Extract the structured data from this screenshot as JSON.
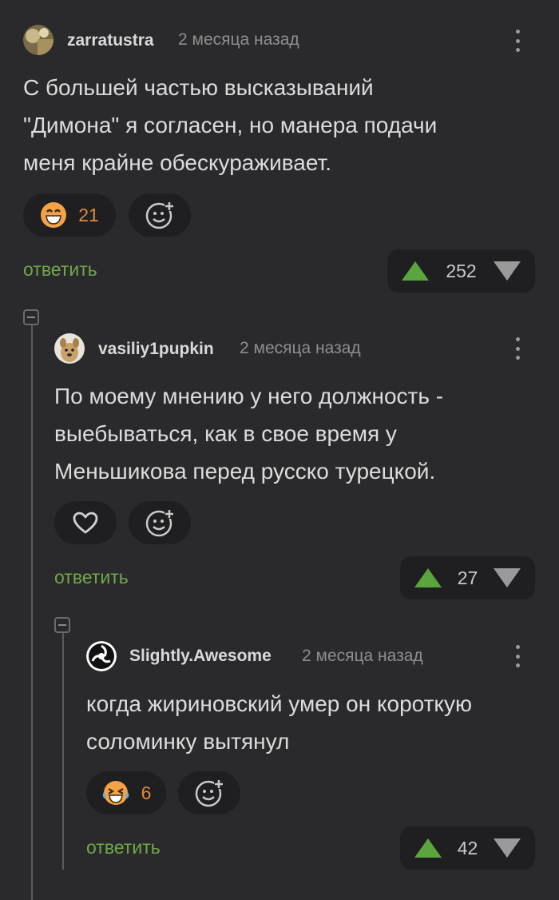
{
  "comments": [
    {
      "author": "zarratustra",
      "time": "2 месяца назад",
      "text_lines": [
        "С большей частью высказываний",
        "\"Димона\" я согласен, но манера подачи",
        "меня крайне обескураживает."
      ],
      "reaction_icon": "grinning-face-icon",
      "reaction_count": "21",
      "reply_label": "ответить",
      "votes": "252"
    },
    {
      "author": "vasiliy1pupkin",
      "time": "2 месяца назад",
      "text_lines": [
        "По моему мнению у него должность -",
        "выебываться, как в свое время у",
        "Меньшикова перед русско турецкой."
      ],
      "reaction_icon": "heart-icon",
      "reply_label": "ответить",
      "votes": "27"
    },
    {
      "author": "Slightly.Awesome",
      "time": "2 месяца назад",
      "text_lines": [
        "когда жириновский умер он короткую",
        "соломинку вытянул"
      ],
      "reaction_icon": "laughing-tears-icon",
      "reaction_count": "6",
      "reply_label": "ответить",
      "votes": "42"
    }
  ],
  "colors": {
    "background": "#2a2a2c",
    "reply": "#6fa848",
    "upvote": "#5aa53d",
    "reaction_count": "#e08a3a"
  }
}
